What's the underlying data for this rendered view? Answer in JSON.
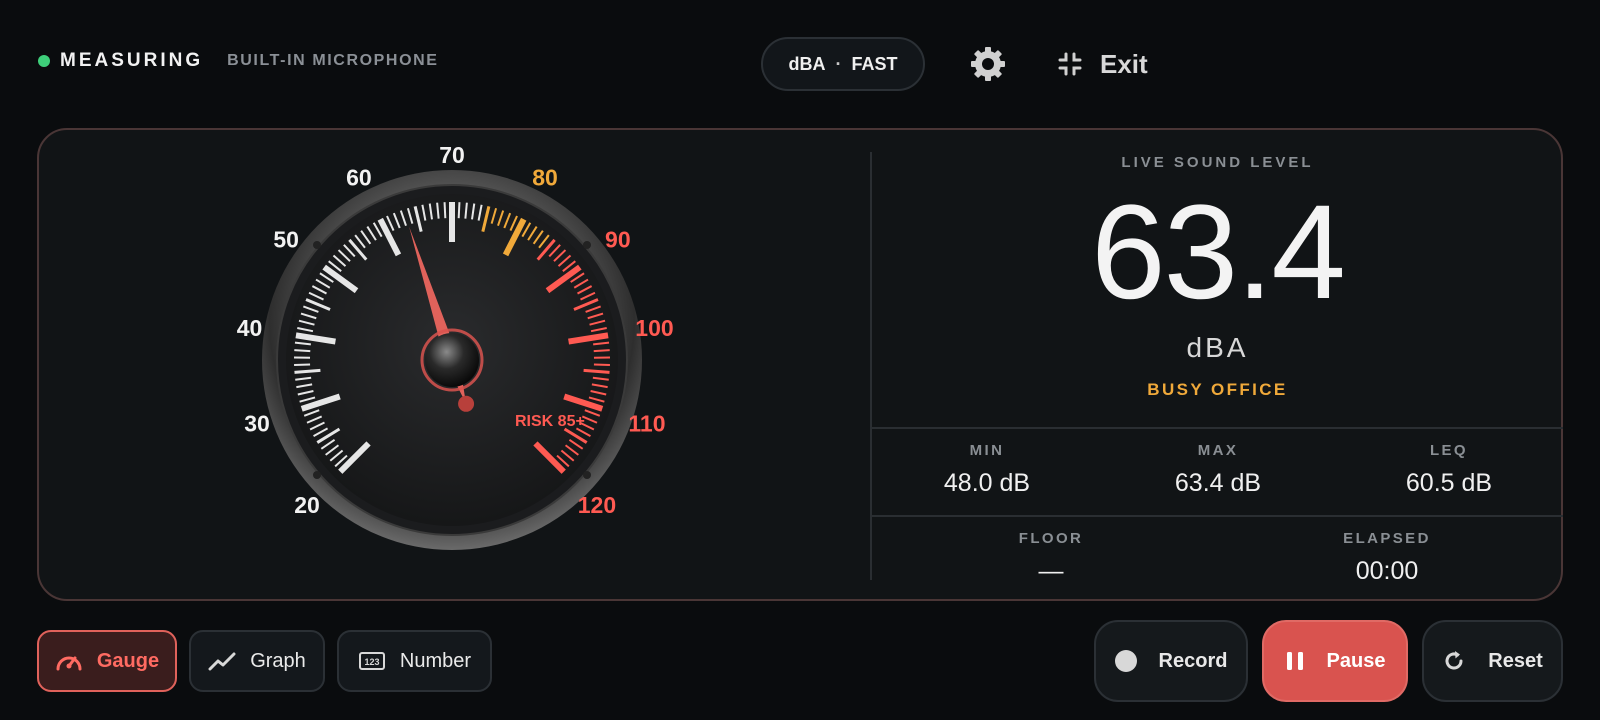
{
  "header": {
    "status": "MEASURING",
    "source": "BUILT-IN MICROPHONE",
    "weighting": "dBA",
    "separator": "·",
    "response": "FAST",
    "exit_label": "Exit"
  },
  "gauge": {
    "scale_labels": [
      "20",
      "30",
      "40",
      "50",
      "60",
      "70",
      "80",
      "90",
      "100",
      "110",
      "120"
    ],
    "risk_label": "RISK 85+",
    "needle_value": 63.4,
    "min": 20,
    "max": 120
  },
  "readout": {
    "live_label": "LIVE SOUND LEVEL",
    "value": "63.4",
    "unit": "dBA",
    "category": "BUSY OFFICE",
    "stats": {
      "min_label": "MIN",
      "min_value": "48.0 dB",
      "max_label": "MAX",
      "max_value": "63.4 dB",
      "leq_label": "LEQ",
      "leq_value": "60.5 dB",
      "floor_label": "FLOOR",
      "floor_value": "—",
      "elapsed_label": "ELAPSED",
      "elapsed_value": "00:00"
    }
  },
  "views": {
    "gauge": "Gauge",
    "graph": "Graph",
    "number": "Number"
  },
  "controls": {
    "record": "Record",
    "pause": "Pause",
    "reset": "Reset"
  },
  "colors": {
    "accent": "#e0625b",
    "warning": "#f0a93a",
    "danger": "#ff5a52",
    "ok": "#3ecf7a"
  }
}
